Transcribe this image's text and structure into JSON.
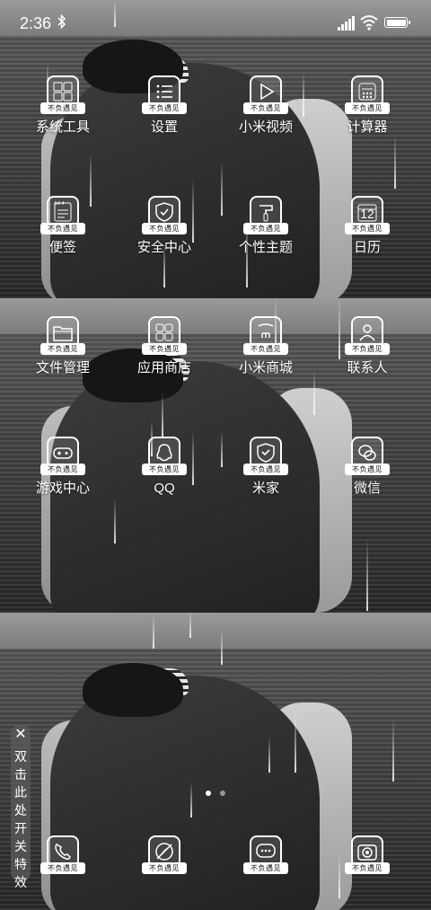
{
  "status_bar": {
    "time": "2:36",
    "battery_level": 1.0
  },
  "icon_tag": "不负遇见",
  "apps": [
    {
      "label": "系统工具",
      "icon": "toolbox-icon"
    },
    {
      "label": "设置",
      "icon": "settings-list-icon"
    },
    {
      "label": "小米视频",
      "icon": "video-play-icon"
    },
    {
      "label": "计算器",
      "icon": "calculator-icon"
    },
    {
      "label": "便签",
      "icon": "notes-icon"
    },
    {
      "label": "安全中心",
      "icon": "shield-check-icon"
    },
    {
      "label": "个性主题",
      "icon": "paint-brush-icon"
    },
    {
      "label": "日历",
      "icon": "calendar-icon"
    },
    {
      "label": "文件管理",
      "icon": "folder-icon"
    },
    {
      "label": "应用商店",
      "icon": "app-store-grid-icon"
    },
    {
      "label": "小米商城",
      "icon": "shopping-bag-icon"
    },
    {
      "label": "联系人",
      "icon": "contact-icon"
    },
    {
      "label": "游戏中心",
      "icon": "gamepad-icon"
    },
    {
      "label": "QQ",
      "icon": "qq-penguin-icon"
    },
    {
      "label": "米家",
      "icon": "mihome-shield-icon"
    },
    {
      "label": "微信",
      "icon": "wechat-icon"
    }
  ],
  "calendar_day": "12",
  "notes_header": "Aril 4",
  "dock": [
    {
      "icon": "phone-icon"
    },
    {
      "icon": "browser-icon"
    },
    {
      "icon": "message-icon"
    },
    {
      "icon": "camera-icon"
    }
  ],
  "effects_toggle": {
    "close": "✕",
    "text": "双击此处开关特效"
  },
  "page_indicator": {
    "count": 2,
    "active": 0
  }
}
